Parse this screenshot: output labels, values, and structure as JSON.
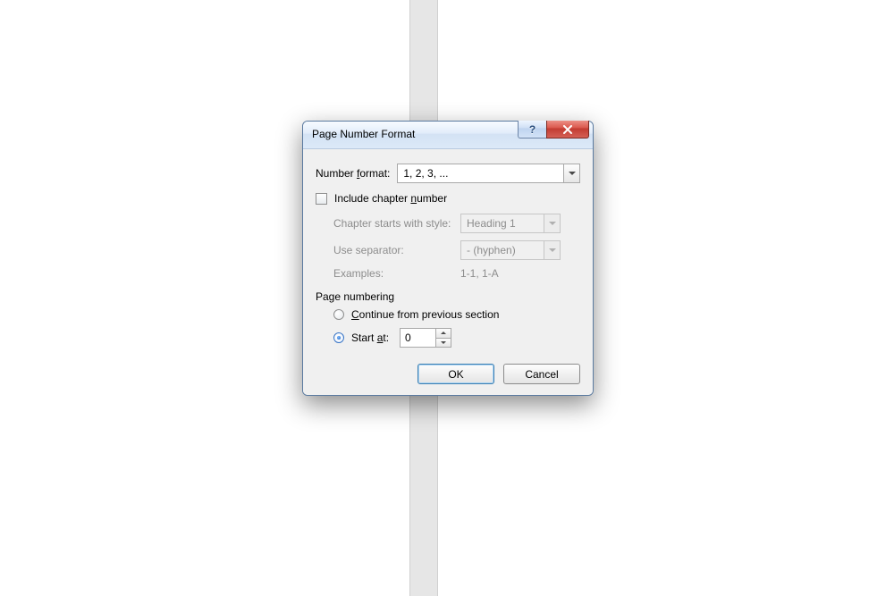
{
  "dialog": {
    "title": "Page Number Format",
    "number_format": {
      "label_pre": "Number ",
      "label_u": "f",
      "label_post": "ormat:",
      "value": "1, 2, 3, ..."
    },
    "chapter": {
      "checkbox_label_pre": "Include chapter ",
      "checkbox_label_u": "n",
      "checkbox_label_post": "umber",
      "checked": false,
      "starts_label": "Chapter starts with style:",
      "starts_value": "Heading 1",
      "separator_label": "Use separator:",
      "separator_value": "-   (hyphen)",
      "examples_label": "Examples:",
      "examples_value": "1-1, 1-A"
    },
    "page_numbering": {
      "group_label": "Page numbering",
      "continue_label_u": "C",
      "continue_label_post": "ontinue from previous section",
      "start_label_pre": "Start ",
      "start_label_u": "a",
      "start_label_post": "t:",
      "selected": "start_at",
      "start_value": "0"
    },
    "buttons": {
      "ok": "OK",
      "cancel": "Cancel"
    }
  }
}
